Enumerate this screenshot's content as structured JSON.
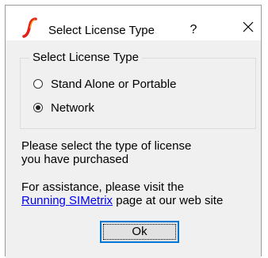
{
  "window": {
    "title": "Select License Type",
    "help_label": "?",
    "icons": {
      "app": "simetrix-logo-icon",
      "close": "close-icon"
    }
  },
  "group": {
    "legend": "Select License Type",
    "options": [
      {
        "label": "Stand Alone or Portable",
        "checked": false
      },
      {
        "label": "Network",
        "checked": true
      }
    ]
  },
  "message": {
    "line1": "Please select the type of license",
    "line2": "you have purchased",
    "line3": "For assistance, please visit the",
    "link_text": "Running SIMetrix",
    "line4_suffix": " page at our web site"
  },
  "buttons": {
    "ok_label": "Ok"
  },
  "colors": {
    "accent": "#0078d7",
    "link": "#0000ee",
    "client_bg": "#f0f0f0"
  }
}
